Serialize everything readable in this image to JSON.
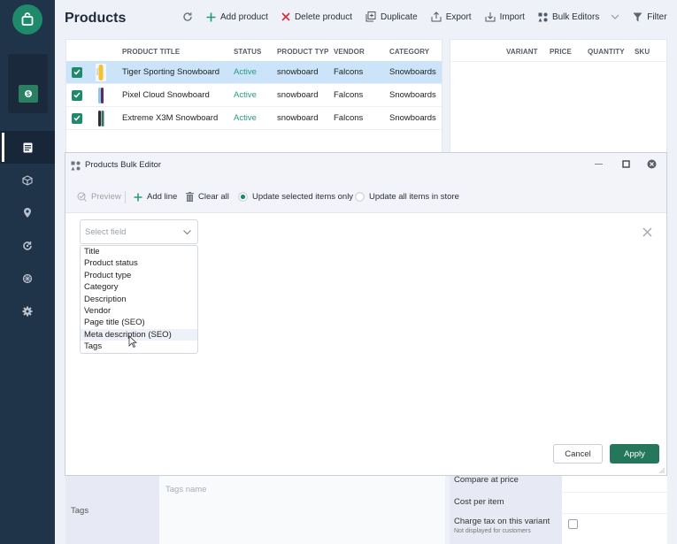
{
  "app": {
    "title": "Products"
  },
  "toolbar": {
    "refresh": "refresh",
    "add_product": "Add product",
    "delete_product": "Delete product",
    "duplicate": "Duplicate",
    "export": "Export",
    "import": "Import",
    "bulk_editors": "Bulk Editors",
    "filter": "Filter"
  },
  "sidebar": {
    "items": [
      {
        "icon": "document-icon",
        "active": true
      },
      {
        "icon": "cube-icon",
        "active": false
      },
      {
        "icon": "location-pin-icon",
        "active": false
      },
      {
        "icon": "sync-icon",
        "active": false
      },
      {
        "icon": "openai-icon",
        "active": false
      },
      {
        "icon": "gear-icon",
        "active": false
      }
    ]
  },
  "products_table": {
    "columns": [
      "PRODUCT TITLE",
      "STATUS",
      "PRODUCT TYP",
      "VENDOR",
      "CATEGORY"
    ],
    "rows": [
      {
        "title": "Tiger Sporting Snowboard",
        "status": "Active",
        "type": "snowboard",
        "vendor": "Falcons",
        "category": "Snowboards",
        "selected": true,
        "checked": true
      },
      {
        "title": "Pixel Cloud Snowboard",
        "status": "Active",
        "type": "snowboard",
        "vendor": "Falcons",
        "category": "Snowboards",
        "selected": false,
        "checked": true
      },
      {
        "title": "Extreme X3M Snowboard",
        "status": "Active",
        "type": "snowboard",
        "vendor": "Falcons",
        "category": "Snowboards",
        "selected": false,
        "checked": true
      }
    ]
  },
  "variants_table": {
    "columns": [
      "VARIANT",
      "PRICE",
      "QUANTITY",
      "SKU"
    ]
  },
  "bulk_editor": {
    "title": "Products Bulk Editor",
    "preview": "Preview",
    "add_line": "Add line",
    "clear_all": "Clear all",
    "update_selected": "Update selected items only",
    "update_all": "Update all items in store",
    "selected_scope": "update_selected",
    "select_placeholder": "Select field",
    "options": [
      "Title",
      "Product status",
      "Product type",
      "Category",
      "Description",
      "Vendor",
      "Page title (SEO)",
      "Meta description (SEO)",
      "Tags"
    ],
    "hovered_option": "Meta description (SEO)",
    "cancel": "Cancel",
    "apply": "Apply"
  },
  "background_form": {
    "tags_label": "Tags",
    "tags_placeholder": "Tags name",
    "compare_at_price": "Compare at price",
    "cost_per_item": "Cost per item",
    "charge_tax": "Charge tax on this variant",
    "charge_tax_note": "Not displayed for customers"
  },
  "colors": {
    "accent": "#1f8a6a",
    "sidebar": "#1f3349",
    "selected_row": "#cce4f9",
    "active_status": "#2a9a7e"
  }
}
